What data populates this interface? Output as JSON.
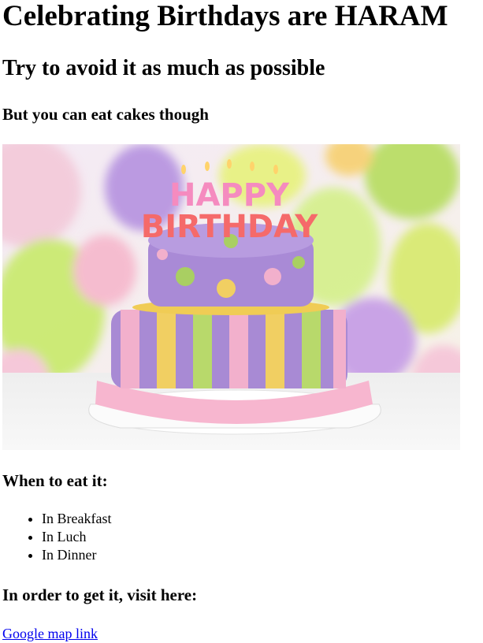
{
  "heading": "Celebrating Birthdays are HARAM",
  "subheading": "Try to avoid it as much as possible",
  "note": "But you can eat cakes though",
  "image": {
    "cake_text_top": "HAPPY",
    "cake_text_bottom": "BIRTHDAY"
  },
  "when_title": "When to eat it:",
  "meals": [
    "In Breakfast",
    "In Luch",
    "In Dinner"
  ],
  "visit_title": "In order to get it, visit here:",
  "map_link": "Google map link",
  "colors": {
    "link": "#0000EE"
  }
}
